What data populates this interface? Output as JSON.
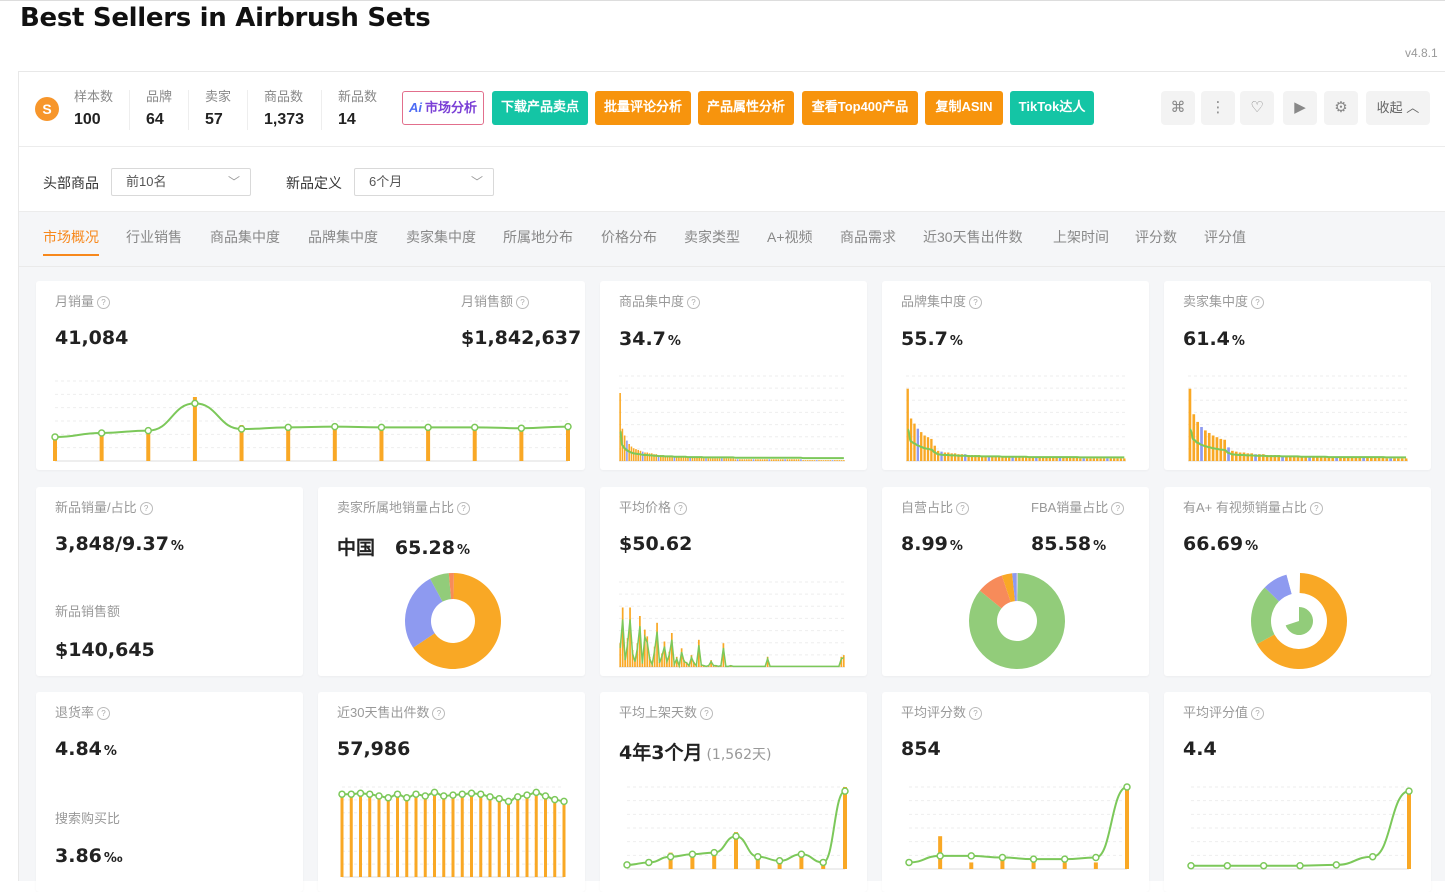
{
  "page": {
    "title": "Best Sellers in Airbrush Sets",
    "version": "v4.8.1"
  },
  "stats": [
    {
      "label": "样本数",
      "value": "100"
    },
    {
      "label": "品牌",
      "value": "64"
    },
    {
      "label": "卖家",
      "value": "57"
    },
    {
      "label": "商品数",
      "value": "1,373"
    },
    {
      "label": "新品数",
      "value": "14"
    }
  ],
  "toolbar": {
    "ai_mark": "Ai",
    "ai_label": "市场分析",
    "download_points": "下载产品卖点",
    "bulk_reviews": "批量评论分析",
    "attributes": "产品属性分析",
    "top400": "查看Top400产品",
    "copy_asin": "复制ASIN",
    "tiktok": "TikTok达人",
    "collapse": "收起"
  },
  "filters": {
    "head_label": "头部商品",
    "head_value": "前10名",
    "new_label": "新品定义",
    "new_value": "6个月"
  },
  "tabs": [
    "市场概况",
    "行业销售",
    "商品集中度",
    "品牌集中度",
    "卖家集中度",
    "所属地分布",
    "价格分布",
    "卖家类型",
    "A+视频",
    "商品需求",
    "近30天售出件数",
    "上架时间",
    "评分数",
    "评分值"
  ],
  "cards": {
    "monthly_sales": {
      "label": "月销量",
      "value": "41,084"
    },
    "monthly_revenue": {
      "label": "月销售额",
      "value": "$1,842,637"
    },
    "product_conc": {
      "label": "商品集中度",
      "value": "34.7",
      "unit": "%"
    },
    "brand_conc": {
      "label": "品牌集中度",
      "value": "55.7",
      "unit": "%"
    },
    "seller_conc": {
      "label": "卖家集中度",
      "value": "61.4",
      "unit": "%"
    },
    "new_sales": {
      "label": "新品销量/占比",
      "value": "3,848/9.37",
      "unit": "%"
    },
    "new_revenue": {
      "label": "新品销售额",
      "value": "$140,645"
    },
    "seller_origin": {
      "label": "卖家所属地销量占比",
      "country": "中国",
      "value": "65.28",
      "unit": "%"
    },
    "avg_price": {
      "label": "平均价格",
      "value": "$50.62"
    },
    "self_operated": {
      "label": "自营占比",
      "value": "8.99",
      "unit": "%"
    },
    "fba": {
      "label": "FBA销量占比",
      "value": "85.58",
      "unit": "%"
    },
    "aplus": {
      "label": "有A+ 有视频销量占比",
      "value": "66.69",
      "unit": "%"
    },
    "return_rate": {
      "label": "退货率",
      "value": "4.84",
      "unit": "%"
    },
    "search_ratio": {
      "label": "搜索购买比",
      "value": "3.86",
      "unit": "‰"
    },
    "sold30": {
      "label": "近30天售出件数",
      "value": "57,986"
    },
    "avg_days": {
      "label": "平均上架天数",
      "value": "4年3个月",
      "sub": "(1,562天)"
    },
    "avg_reviews": {
      "label": "平均评分数",
      "value": "854"
    },
    "avg_rating": {
      "label": "平均评分值",
      "value": "4.4"
    }
  },
  "colors": {
    "accent": "#f7881c",
    "bar": "#f9a825",
    "line": "#7cc85a",
    "teal": "#14c5a5",
    "orange": "#f7940d",
    "blue": "#8e9af0",
    "green": "#92cc7a"
  },
  "chart_data": [
    {
      "type": "bar",
      "name": "monthly_sales",
      "values": [
        30,
        35,
        38,
        80,
        45,
        44,
        44,
        44,
        44,
        44,
        44,
        46
      ],
      "line": [
        30,
        35,
        38,
        72,
        40,
        42,
        43,
        42,
        42,
        42,
        41,
        43
      ],
      "ylim": [
        0,
        100
      ]
    },
    {
      "type": "bar",
      "name": "product_concentration",
      "values": [
        80,
        38,
        30,
        24,
        20,
        17,
        15,
        14,
        13,
        12,
        11,
        10,
        10,
        9,
        9,
        8,
        8,
        7,
        7,
        7,
        6,
        6,
        6,
        6,
        5,
        5,
        5,
        5,
        5,
        5,
        4,
        4,
        4,
        4,
        4,
        4,
        4,
        3,
        3,
        3,
        3,
        3,
        3,
        3,
        3,
        3,
        3,
        3,
        3,
        3,
        3,
        2,
        2,
        2,
        2,
        2,
        2,
        2,
        2,
        2,
        2,
        2,
        2,
        2,
        2,
        2,
        2,
        2,
        2,
        2,
        2,
        2,
        2,
        2,
        2,
        2,
        2,
        2,
        2,
        2,
        2,
        1,
        1,
        1,
        1,
        1,
        1,
        1,
        1,
        1,
        1,
        1,
        1,
        1,
        1,
        1,
        1,
        1,
        1,
        1
      ],
      "ylim": [
        0,
        100
      ]
    },
    {
      "type": "bar",
      "name": "brand_concentration",
      "values": [
        85,
        50,
        44,
        38,
        34,
        30,
        28,
        26,
        18,
        12,
        11,
        10,
        10,
        9,
        9,
        8,
        8,
        8,
        7,
        7,
        7,
        7,
        6,
        6,
        6,
        6,
        6,
        6,
        5,
        5,
        5,
        5,
        5,
        5,
        5,
        5,
        4,
        4,
        4,
        4,
        4,
        4,
        4,
        4,
        4,
        4,
        4,
        4,
        4,
        4,
        4,
        3,
        3,
        3,
        3,
        3,
        3,
        3,
        3,
        3,
        3,
        3,
        3,
        3,
        3
      ],
      "ylim": [
        0,
        100
      ]
    },
    {
      "type": "bar",
      "name": "seller_concentration",
      "values": [
        85,
        55,
        46,
        40,
        36,
        33,
        30,
        28,
        26,
        25,
        16,
        12,
        11,
        10,
        10,
        9,
        9,
        8,
        8,
        8,
        7,
        7,
        7,
        7,
        6,
        6,
        6,
        6,
        6,
        5,
        5,
        5,
        5,
        5,
        5,
        5,
        4,
        4,
        4,
        4,
        4,
        4,
        4,
        4,
        4,
        4,
        4,
        4,
        4,
        4,
        4,
        3,
        3,
        3,
        3,
        3,
        3
      ],
      "ylim": [
        0,
        100
      ]
    },
    {
      "type": "pie",
      "name": "seller_origin",
      "values": [
        65.28,
        26.5,
        6.5,
        1.72
      ],
      "labels": [
        "中国",
        "",
        "",
        ""
      ]
    },
    {
      "type": "bar",
      "name": "price_distribution",
      "values": [
        28,
        70,
        10,
        34,
        70,
        20,
        8,
        28,
        60,
        5,
        44,
        36,
        12,
        4,
        24,
        52,
        6,
        16,
        30,
        8,
        18,
        40,
        4,
        12,
        2,
        22,
        8,
        6,
        2,
        14,
        6,
        2,
        32,
        3,
        2,
        1,
        2,
        8,
        2,
        2,
        1,
        2,
        28,
        1,
        1,
        2,
        1,
        1,
        1,
        1,
        1,
        1,
        1,
        1,
        1,
        1,
        1,
        1,
        1,
        1,
        12,
        1,
        1,
        1,
        1,
        1,
        1,
        1,
        1,
        1,
        1,
        1,
        1,
        1,
        1,
        1,
        1,
        1,
        1,
        1,
        1,
        1,
        1,
        1,
        1,
        1,
        1,
        1,
        1,
        1,
        12,
        14
      ],
      "ylim": [
        0,
        100
      ]
    },
    {
      "type": "pie",
      "name": "self_fba",
      "values": [
        85.58,
        8.99,
        3.5,
        1.5,
        0.43
      ]
    },
    {
      "type": "pie",
      "name": "aplus_video",
      "values": [
        66.69,
        20.31,
        8.5,
        4.5
      ]
    },
    {
      "type": "bar",
      "name": "sold_30d",
      "values": [
        92,
        92,
        93,
        92,
        90,
        88,
        92,
        88,
        92,
        90,
        94,
        90,
        91,
        92,
        93,
        92,
        89,
        87,
        84,
        89,
        91,
        94,
        90,
        86,
        84
      ],
      "line": [
        92,
        92,
        93,
        92,
        90,
        88,
        92,
        88,
        92,
        90,
        94,
        90,
        91,
        92,
        93,
        92,
        89,
        87,
        84,
        89,
        91,
        94,
        90,
        86,
        84
      ],
      "ylim": [
        0,
        100
      ]
    },
    {
      "type": "bar",
      "name": "listing_days",
      "values": [
        0,
        0,
        20,
        18,
        22,
        45,
        18,
        14,
        18,
        8,
        100
      ],
      "line": [
        5,
        8,
        15,
        18,
        20,
        40,
        15,
        10,
        18,
        8,
        95
      ],
      "ylim": [
        0,
        100
      ]
    },
    {
      "type": "bar",
      "name": "review_count",
      "values": [
        0,
        40,
        8,
        12,
        10,
        8,
        8,
        100
      ],
      "line": [
        8,
        16,
        16,
        14,
        12,
        12,
        14,
        100
      ],
      "ylim": [
        0,
        100
      ]
    },
    {
      "type": "bar",
      "name": "rating",
      "values": [
        0,
        0,
        0,
        0,
        0,
        0,
        95
      ],
      "line": [
        4,
        4,
        4,
        4,
        5,
        15,
        95
      ],
      "ylim": [
        0,
        100
      ]
    }
  ]
}
